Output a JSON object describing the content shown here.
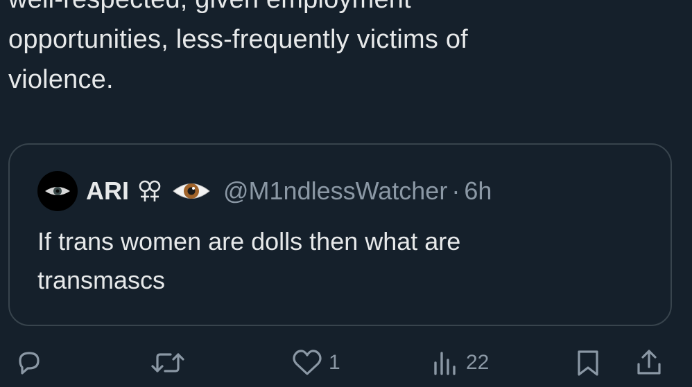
{
  "tweet": {
    "text_lines": [
      "well-respected, given employment",
      "opportunities, less-frequently victims of",
      "violence."
    ]
  },
  "quote": {
    "name": "ARI",
    "handle": "@M1ndlessWatcher",
    "separator": "·",
    "time": "6h",
    "name_icons": [
      "double-venus-icon",
      "eye-icon"
    ],
    "text_lines": [
      "If trans women are dolls then what are",
      "transmascs"
    ]
  },
  "actions": {
    "reply": {
      "icon": "reply-icon",
      "count": ""
    },
    "retweet": {
      "icon": "retweet-icon",
      "count": ""
    },
    "like": {
      "icon": "heart-icon",
      "count": "1"
    },
    "views": {
      "icon": "views-icon",
      "count": "22"
    },
    "bookmark": {
      "icon": "bookmark-icon"
    },
    "share": {
      "icon": "share-icon"
    }
  },
  "colors": {
    "background": "#15202b",
    "text": "#e7e9ea",
    "secondary_text": "#8b98a5",
    "border": "#38444d"
  }
}
